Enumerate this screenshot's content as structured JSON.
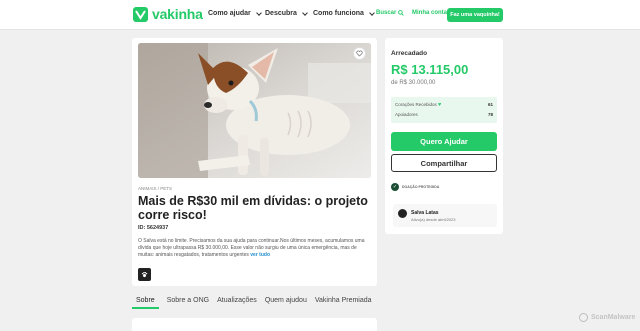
{
  "header": {
    "logo_text": "vakinha",
    "nav": [
      {
        "label": "Como ajudar"
      },
      {
        "label": "Descubra"
      },
      {
        "label": "Como funciona"
      }
    ],
    "search_label": "Buscar",
    "account_label": "Minha conta",
    "cta_label": "Faz uma vaquinha!"
  },
  "campaign": {
    "category": "ANIMAIS / PETS",
    "title": "Mais de R$30 mil em dívidas: o projeto corre risco!",
    "id_text": "ID: 5624937",
    "description": "O Salva está no limite. Precisamos da sua ajuda para continuar.Nos últimos meses, acumulamos uma dívida que hoje ultrapassa R$ 30.000,00. Esse valor não surgiu de uma única emergência, mas de muitas: animais resgatados, tratamentos urgentes",
    "read_more": "ver tudo"
  },
  "tabs": [
    {
      "label": "Sobre"
    },
    {
      "label": "Sobre a ONG"
    },
    {
      "label": "Atualizações"
    },
    {
      "label": "Quem ajudou"
    },
    {
      "label": "Vakinha Premiada"
    }
  ],
  "sidebar": {
    "raised_label": "Arrecadado",
    "raised_value": "R$ 13.115,00",
    "goal_text": "de R$ 30.000,00",
    "stats": [
      {
        "label": "Corações Recebidos",
        "value": "61"
      },
      {
        "label": "Apoiadores",
        "value": "78"
      }
    ],
    "primary_button": "Quero Ajudar",
    "secondary_button": "Compartilhar",
    "protection_label": "DOAÇÃO PROTEGIDA",
    "organizer_name": "Salva Latas",
    "organizer_since": "Ativo(a) desde abril/2023"
  },
  "watermark": "ScanMalware",
  "colors": {
    "brand_green": "#24ca68",
    "link_blue": "#1f8ccf"
  }
}
